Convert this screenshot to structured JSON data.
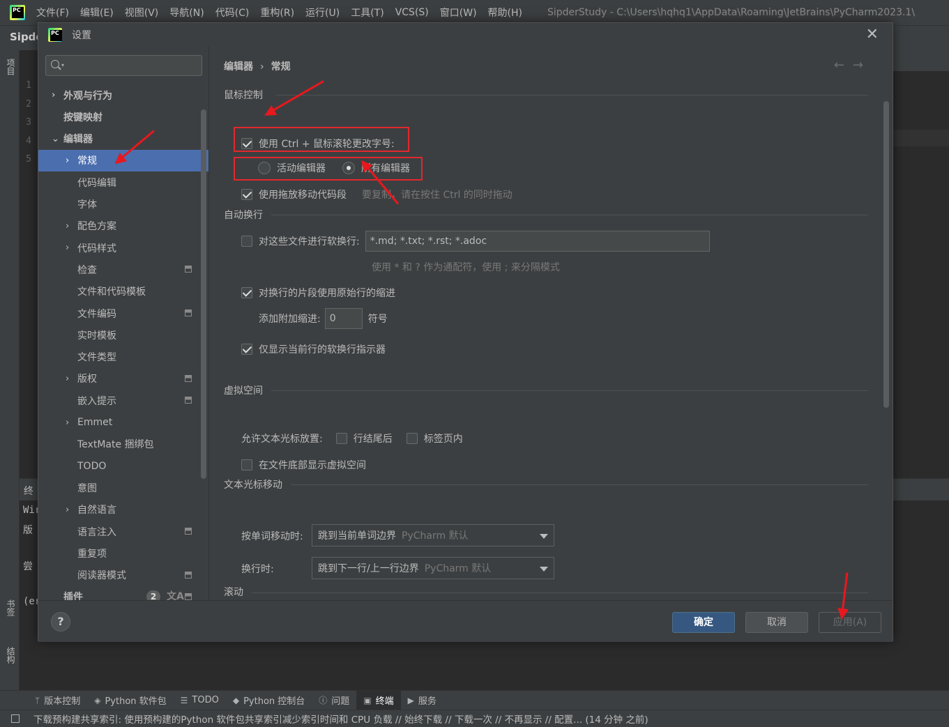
{
  "ide": {
    "menu": [
      "文件(F)",
      "编辑(E)",
      "视图(V)",
      "导航(N)",
      "代码(C)",
      "重构(R)",
      "运行(U)",
      "工具(T)",
      "VCS(S)",
      "窗口(W)",
      "帮助(H)"
    ],
    "window_title": "SipderStudy - C:\\Users\\hqhq1\\AppData\\Roaming\\JetBrains\\PyCharm2023.1\\",
    "project_name": "Sipde",
    "left_strip": {
      "project": "项目",
      "bookmarks": "书签",
      "structure": "结构"
    },
    "line_numbers": [
      "1",
      "2",
      "3",
      "4",
      "5"
    ],
    "terminal_label": "终",
    "terminal_lines": [
      "Wir",
      "版",
      "尝",
      "(er"
    ],
    "bottom_tabs": [
      {
        "icon": "ᛘ",
        "label": "版本控制"
      },
      {
        "icon": "◈",
        "label": "Python 软件包"
      },
      {
        "icon": "☰",
        "label": "TODO"
      },
      {
        "icon": "◆",
        "label": "Python 控制台"
      },
      {
        "icon": "ⓘ",
        "label": "问题"
      },
      {
        "icon": "▣",
        "label": "终端"
      },
      {
        "icon": "▶",
        "label": "服务"
      }
    ],
    "status_text": "下载预构建共享索引: 使用预构建的Python 软件包共享索引减少索引时间和 CPU 负载 // 始终下载 // 下载一次 // 不再显示 // 配置... (14 分钟 之前)"
  },
  "dialog": {
    "title": "设置",
    "close": "✕",
    "sidebar": {
      "items": [
        {
          "label": "外观与行为",
          "chevron": "›",
          "bold": true
        },
        {
          "label": "按键映射",
          "chevron": "",
          "bold": true
        },
        {
          "label": "编辑器",
          "chevron": "⌄",
          "bold": true
        },
        {
          "label": "常规",
          "chevron": "›",
          "selected": true
        },
        {
          "label": "代码编辑",
          "chevron": ""
        },
        {
          "label": "字体",
          "chevron": ""
        },
        {
          "label": "配色方案",
          "chevron": "›"
        },
        {
          "label": "代码样式",
          "chevron": "›"
        },
        {
          "label": "检查",
          "chevron": "",
          "badge": true
        },
        {
          "label": "文件和代码模板",
          "chevron": ""
        },
        {
          "label": "文件编码",
          "chevron": "",
          "badge": true
        },
        {
          "label": "实时模板",
          "chevron": ""
        },
        {
          "label": "文件类型",
          "chevron": ""
        },
        {
          "label": "版权",
          "chevron": "›",
          "badge": true
        },
        {
          "label": "嵌入提示",
          "chevron": "",
          "badge": true
        },
        {
          "label": "Emmet",
          "chevron": "›"
        },
        {
          "label": "TextMate 捆绑包",
          "chevron": ""
        },
        {
          "label": "TODO",
          "chevron": ""
        },
        {
          "label": "意图",
          "chevron": ""
        },
        {
          "label": "自然语言",
          "chevron": "›"
        },
        {
          "label": "语言注入",
          "chevron": "",
          "badge": true
        },
        {
          "label": "重复项",
          "chevron": ""
        },
        {
          "label": "阅读器模式",
          "chevron": "",
          "badge": true
        },
        {
          "label": "插件",
          "chevron": "",
          "bold": true,
          "badge": true,
          "count": "2",
          "translate": "文A"
        }
      ]
    },
    "breadcrumb": {
      "parent": "编辑器",
      "sep": "›",
      "current": "常规"
    },
    "nav_arrows": "←→",
    "mouse": {
      "title": "鼠标控制",
      "ctrl_wheel": "使用 Ctrl + 鼠标滚轮更改字号:",
      "radio_active": "活动编辑器",
      "radio_all": "所有编辑器",
      "drag_drop": "使用拖放移动代码段",
      "drag_hint": "要复制，请在按住 Ctrl 的同时拖动"
    },
    "softwrap": {
      "title": "自动换行",
      "files_label": "对这些文件进行软换行:",
      "files_value": "*.md; *.txt; *.rst; *.adoc",
      "files_hint": "使用 * 和 ? 作为通配符，使用 ; 来分隔模式",
      "original_indent": "对换行的片段使用原始行的缩进",
      "extra_indent_label": "添加附加缩进:",
      "extra_indent_value": "0",
      "extra_indent_unit": "符号",
      "current_line_only": "仅显示当前行的软换行指示器"
    },
    "virtual_space": {
      "title": "虚拟空间",
      "allow_label": "允许文本光标放置:",
      "after_line_end": "行结尾后",
      "inside_tabs": "标签页内",
      "show_bottom": "在文件底部显示虚拟空间"
    },
    "caret": {
      "title": "文本光标移动",
      "word_label": "按单词移动时:",
      "word_value": "跳到当前单词边界",
      "word_default": "PyCharm 默认",
      "line_label": "换行时:",
      "line_value": "跳到下一行/上一行边界",
      "line_default": "PyCharm 默认"
    },
    "scroll_title": "滚动",
    "footer": {
      "help": "?",
      "ok": "确定",
      "cancel": "取消",
      "apply": "应用(A)"
    }
  },
  "colors": {
    "accent": "#4b6eaf",
    "annotation": "#e3272d",
    "primary_button": "#365880"
  }
}
